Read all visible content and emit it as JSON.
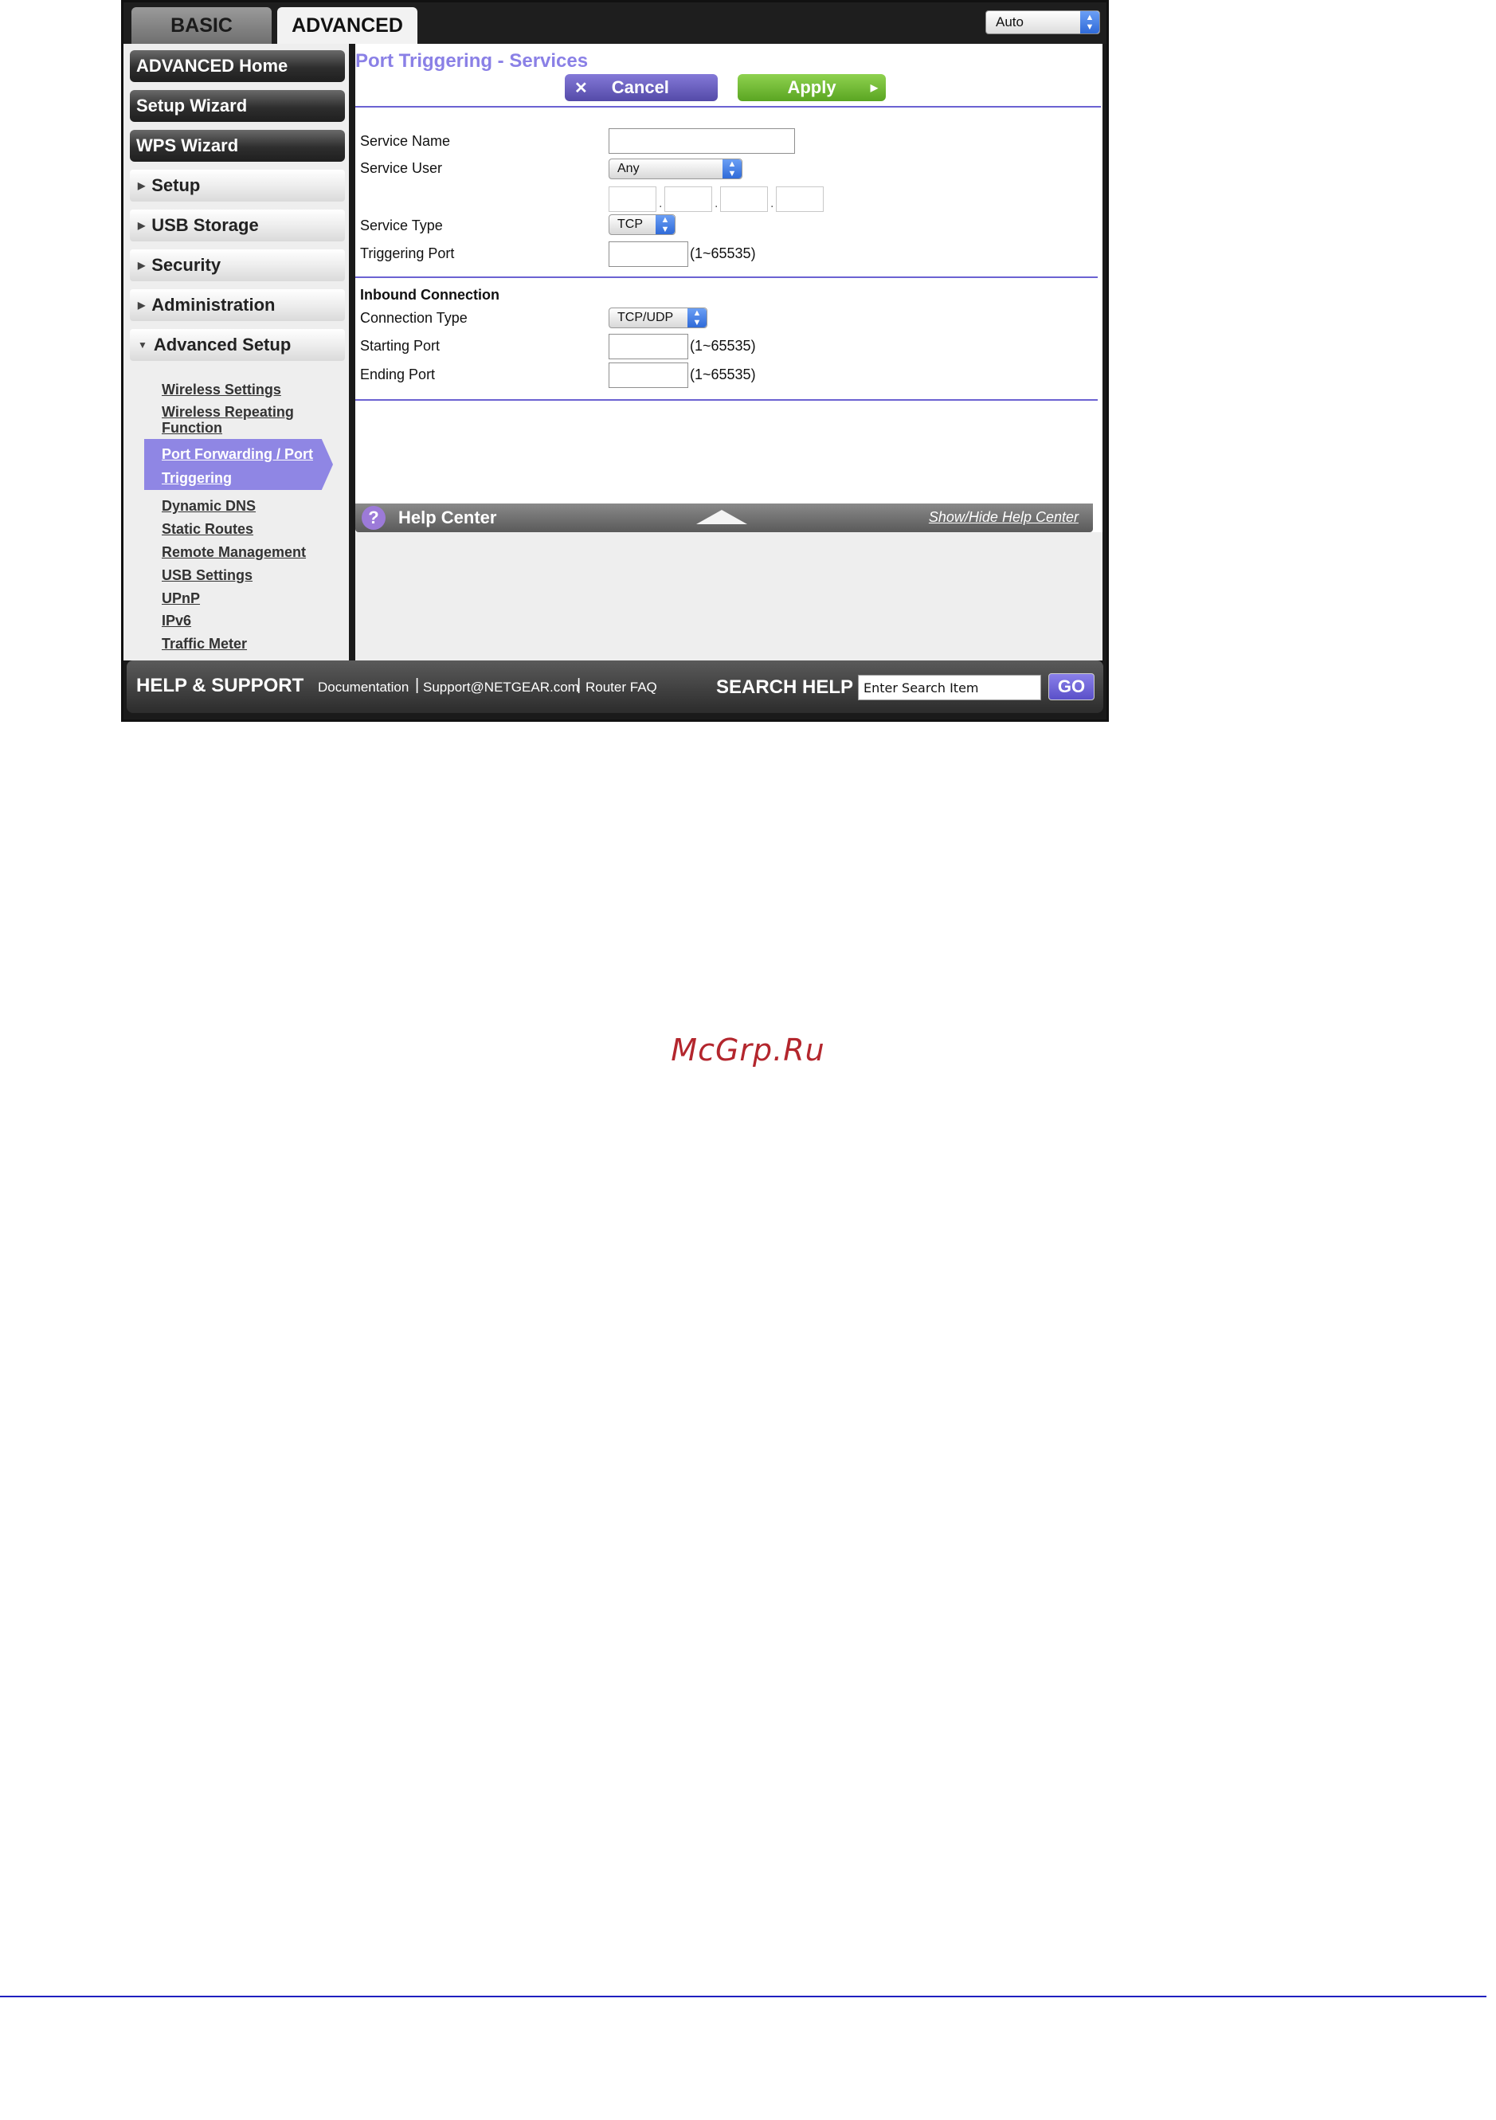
{
  "tabs": {
    "basic": "BASIC",
    "advanced": "ADVANCED"
  },
  "language_select": {
    "value": "Auto"
  },
  "sidebar": {
    "main_buttons": [
      "ADVANCED Home",
      "Setup Wizard",
      "WPS Wizard"
    ],
    "sections": [
      "Setup",
      "USB Storage",
      "Security",
      "Administration",
      "Advanced Setup"
    ],
    "advanced_setup_items": [
      "Wireless Settings",
      "Wireless Repeating",
      "Function",
      "Port Forwarding / Port",
      "Triggering",
      "Dynamic DNS",
      "Static Routes",
      "Remote Management",
      "USB Settings",
      "UPnP",
      "IPv6",
      "Traffic Meter"
    ]
  },
  "page": {
    "title": "Port Triggering - Services",
    "cancel_label": "Cancel",
    "apply_label": "Apply",
    "fields": {
      "service_name": "Service Name",
      "service_user": "Service User",
      "service_user_value": "Any",
      "service_type": "Service Type",
      "service_type_value": "TCP",
      "triggering_port": "Triggering Port",
      "range_hint": "(1~65535)"
    },
    "inbound": {
      "heading": "Inbound Connection",
      "connection_type": "Connection Type",
      "connection_type_value": "TCP/UDP",
      "starting_port": "Starting Port",
      "ending_port": "Ending Port"
    }
  },
  "help_center": {
    "title": "Help Center",
    "toggle": "Show/Hide Help Center",
    "icon": "?"
  },
  "footer": {
    "title": "HELP & SUPPORT",
    "links": [
      "Documentation",
      "Support@NETGEAR.com",
      "Router FAQ"
    ],
    "separator": "|",
    "search_label": "SEARCH HELP",
    "search_value": "Enter Search Item",
    "go_label": "GO"
  },
  "watermark": "McGrp.Ru",
  "colors": {
    "accent": "#8a80e6",
    "apply_green": "#6cb52f",
    "cancel_purple": "#6a5fc0",
    "watermark_red": "#b3262d"
  }
}
